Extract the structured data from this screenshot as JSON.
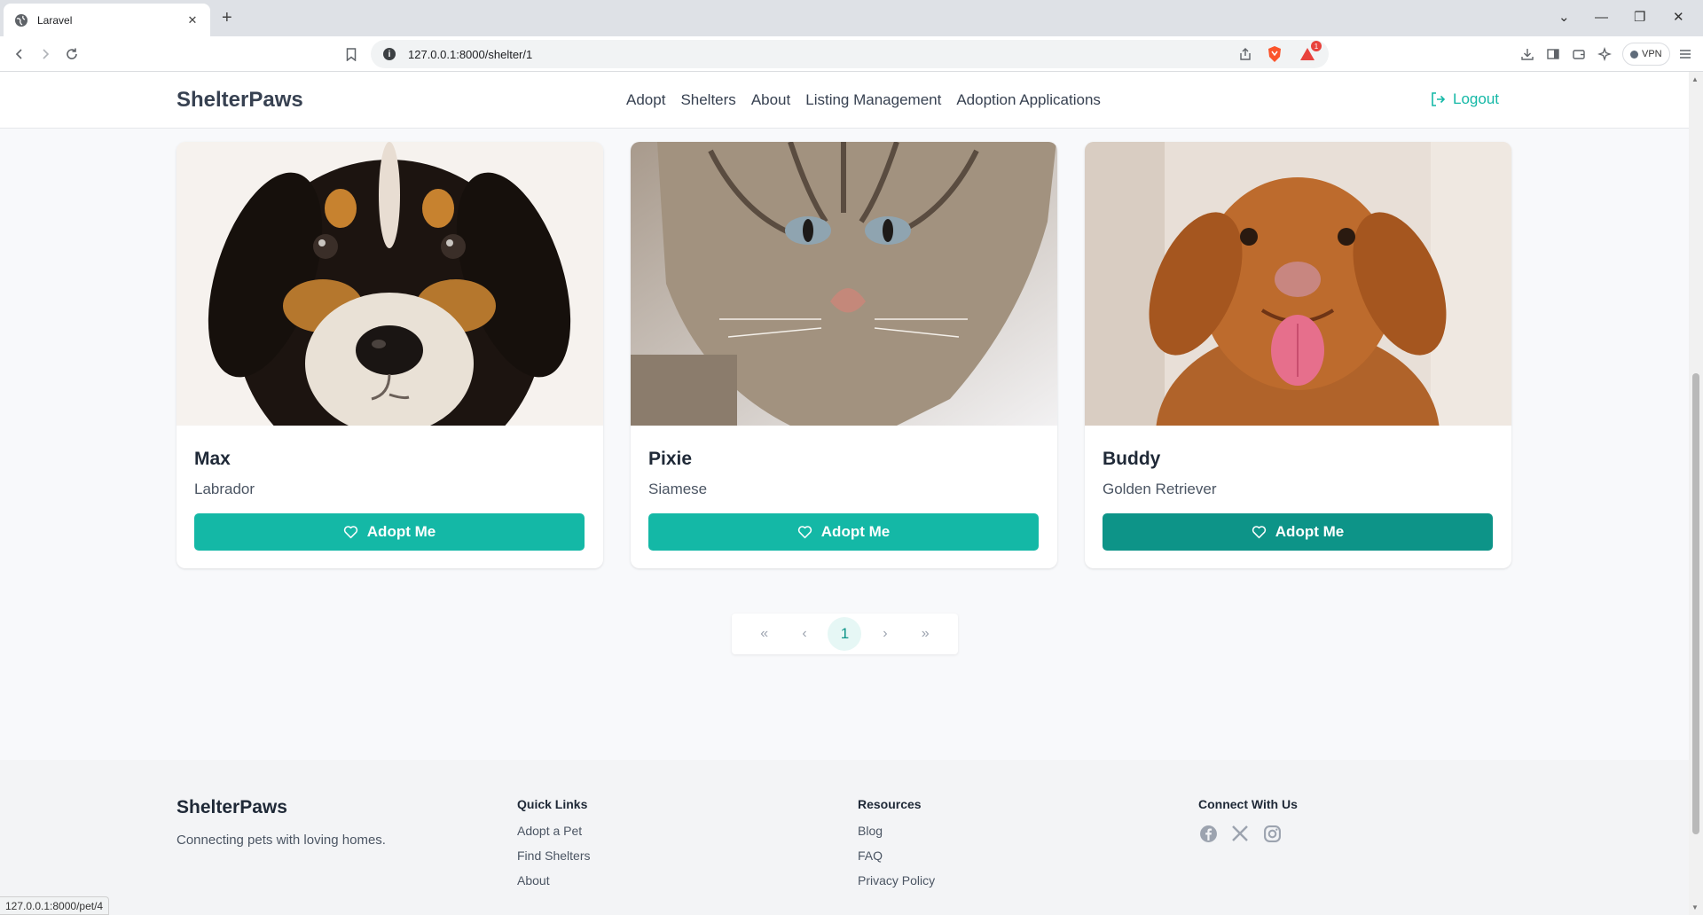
{
  "browser": {
    "tab_title": "Laravel",
    "url": "127.0.0.1:8000/shelter/1",
    "vpn_label": "VPN",
    "notification_count": "1",
    "status_url": "127.0.0.1:8000/pet/4"
  },
  "nav": {
    "brand": "ShelterPaws",
    "links": [
      "Adopt",
      "Shelters",
      "About",
      "Listing Management",
      "Adoption Applications"
    ],
    "logout_label": "Logout"
  },
  "pets": [
    {
      "name": "Max",
      "breed": "Labrador",
      "button": "Adopt Me"
    },
    {
      "name": "Pixie",
      "breed": "Siamese",
      "button": "Adopt Me"
    },
    {
      "name": "Buddy",
      "breed": "Golden Retriever",
      "button": "Adopt Me"
    }
  ],
  "pagination": {
    "first": "«",
    "prev": "‹",
    "current_page": "1",
    "next": "›",
    "last": "»"
  },
  "footer": {
    "brand": "ShelterPaws",
    "tagline": "Connecting pets with loving homes.",
    "quick_links": {
      "heading": "Quick Links",
      "items": [
        "Adopt a Pet",
        "Find Shelters",
        "About"
      ]
    },
    "resources": {
      "heading": "Resources",
      "items": [
        "Blog",
        "FAQ",
        "Privacy Policy"
      ]
    },
    "connect": {
      "heading": "Connect With Us",
      "icons": [
        "facebook-icon",
        "x-icon",
        "instagram-icon"
      ]
    }
  },
  "colors": {
    "accent": "#14b8a6",
    "accent_hover": "#0d9488"
  }
}
